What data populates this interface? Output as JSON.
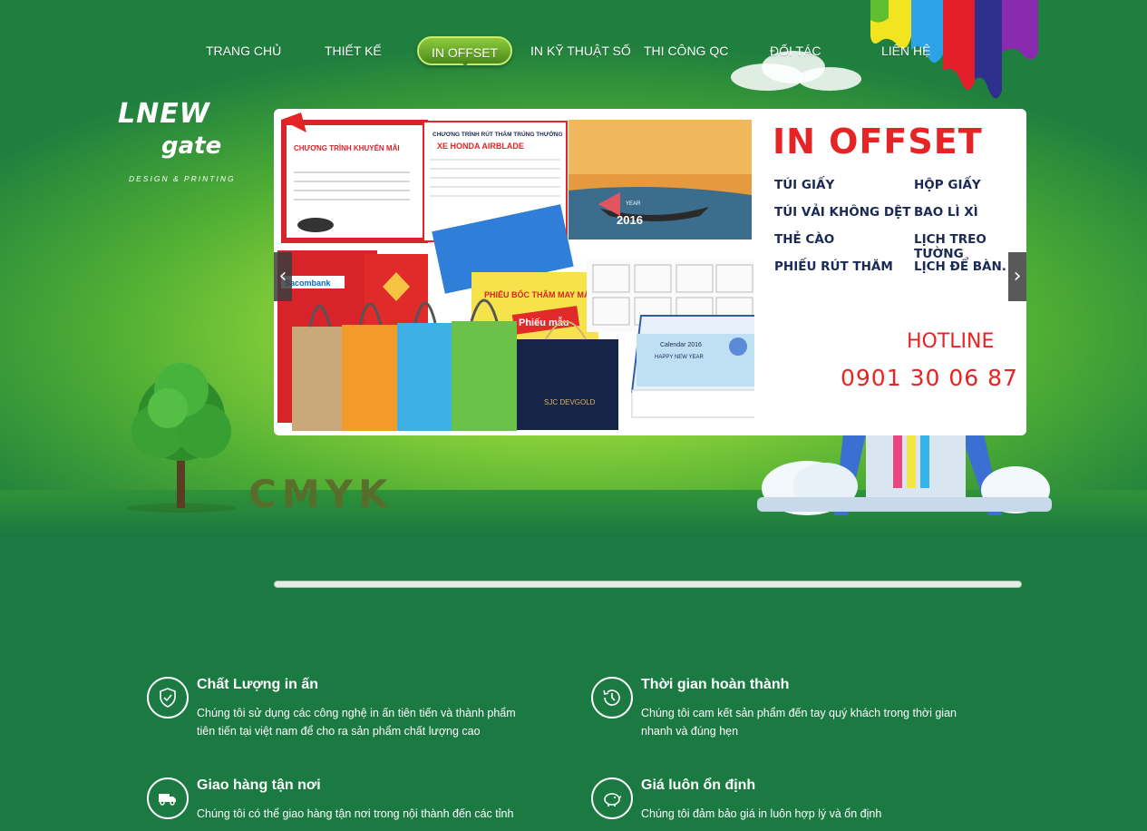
{
  "nav": {
    "items": [
      {
        "label": "TRANG CHỦ"
      },
      {
        "label": "THIẾT KẾ"
      },
      {
        "label": "IN OFFSET"
      },
      {
        "label": "IN KỸ THUẬT SỐ"
      },
      {
        "label": "THI CÔNG QC"
      },
      {
        "label": "ĐỐI TÁC"
      },
      {
        "label": "LIÊN HỆ"
      }
    ],
    "active_index": 2
  },
  "logo": {
    "main": "LNEW",
    "sub": "gate",
    "tagline": "DESIGN & PRINTING"
  },
  "hero": {
    "cmyk_text": "CMYK"
  },
  "slider": {
    "title": "IN OFFSET",
    "services": [
      "TÚI GIẤY",
      "HỘP GIẤY",
      "TÚI VẢI KHÔNG DỆT",
      "BAO LÌ XÌ",
      "THẺ CÀO",
      "LỊCH TREO TƯỜNG",
      "PHIẾU RÚT THĂM",
      "LỊCH ĐỂ BÀN."
    ],
    "hotline_label": "HOTLINE",
    "hotline_number": "0901 30 06 87",
    "prev_icon": "chevron-left-icon",
    "next_icon": "chevron-right-icon",
    "prev_glyph": "‹",
    "next_glyph": "›",
    "art_texts": {
      "promo_title": "CHƯƠNG TRÌNH KHUYẾN MÃI",
      "draw_title": "CHƯƠNG TRÌNH RÚT THĂM TRÚNG THƯỞNG",
      "draw_prize": "XE HONDA AIRBLADE",
      "year": "2016",
      "year_label": "YEAR",
      "scratch_title": "PHIẾU BỐC THĂM MAY MẮN",
      "scratch_label": "Phiếu mẫu",
      "bank": "Sacombank",
      "bag_brand": "SJC DEVGOLD",
      "calendar_title": "Calendar 2016",
      "calendar_sub": "HAPPY NEW YEAR"
    }
  },
  "features": [
    {
      "icon": "shield-check-icon",
      "title": "Chất Lượng in ấn",
      "text": "Chúng tôi sử dụng các công nghệ in ấn tiên tiến và thành phẩm tiên tiến tại việt nam để cho ra sản phẩm chất lượng cao"
    },
    {
      "icon": "clock-history-icon",
      "title": "Thời gian hoàn thành",
      "text": "Chúng tôi cam kết sản phẩm đến tay quý khách trong thời gian nhanh và đúng hẹn"
    },
    {
      "icon": "truck-icon",
      "title": "Giao hàng tận nơi",
      "text": "Chúng tôi có thể giao hàng tận nơi trong nội thành đến các tỉnh"
    },
    {
      "icon": "piggy-bank-icon",
      "title": "Giá luôn ổn định",
      "text": "Chúng tôi đảm bảo giá  in luôn hợp lý và ổn định"
    }
  ],
  "colors": {
    "page_bg": "#1b7a42",
    "accent_red": "#e52525",
    "service_text": "#1b2a55"
  }
}
